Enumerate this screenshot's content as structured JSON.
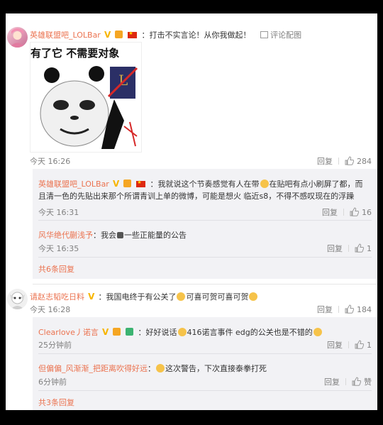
{
  "comment1": {
    "user": "英雄联盟吧_LOLBar",
    "text": "：打击不实言论！从你我做起！",
    "view_pic": "评论配图",
    "meme_caption": "有了它 不需要对象",
    "time": "今天 16:26",
    "reply": "回复",
    "likes": "284",
    "replies": [
      {
        "user": "英雄联盟吧_LOLBar",
        "line1": "：我就说这个节奏感觉有人在带",
        "line1b": "在贴吧有点小刷屏了都，而",
        "line2": "且清一色的先贴出来那个所谓青训上单的微博，可能是想火 临近s8，不得不感叹现在的浮躁",
        "time": "今天 16:31",
        "reply": "回复",
        "likes": "16"
      },
      {
        "user": "风华绝代蒯浅予",
        "text": "：我会",
        "text2": "一些正能量的公告",
        "time": "今天 16:35",
        "reply": "回复",
        "likes": "1"
      }
    ],
    "more": "共6条回复"
  },
  "comment2": {
    "user": "请赵志韬吃日料",
    "text": "：我国电终于有公关了",
    "text2": "可喜可贺可喜可贺",
    "time": "今天 16:28",
    "reply": "回复",
    "likes": "184",
    "replies": [
      {
        "user": "Clearlove丿诺言",
        "text": "：好好说话",
        "text2": "416诺言事件 edg的公关也是不错的",
        "time": "25分钟前",
        "reply": "回复",
        "likes": "1"
      },
      {
        "user": "但偏偏_风渐渐_把距离吹得好远",
        "text": "：",
        "text2": "这次警告，下次直接泰拳打死",
        "time": "6分钟前",
        "reply": "回复",
        "likes": "赞"
      }
    ],
    "more": "共3条回复"
  },
  "colors": {
    "link": "#eb7350",
    "reply_bg": "#f2f2f5",
    "muted": "#808080"
  }
}
